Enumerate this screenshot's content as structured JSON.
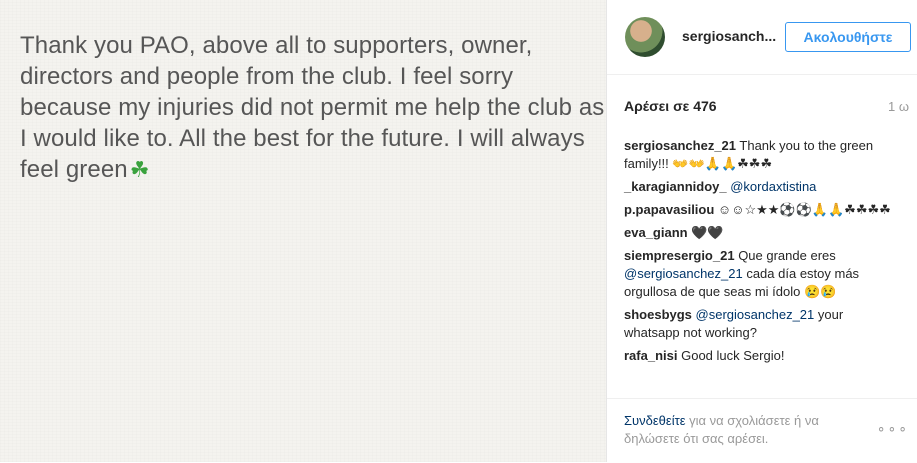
{
  "post": {
    "text": "Thank you PAO, above all to supporters, owner, directors and people from the club. I feel sorry because my injuries did not permit me help the club as I would like to. All the best for the future. I will always feel green",
    "emoji": "☘"
  },
  "header": {
    "username": "sergiosanch...",
    "follow_label": "Ακολουθήστε"
  },
  "meta": {
    "likes": "Αρέσει σε 476",
    "time": "1 ω"
  },
  "comments": [
    {
      "user": "sergiosanchez_21",
      "mention": "",
      "text": " Thank you to the green family!!! 👐👐🙏🙏☘☘☘"
    },
    {
      "user": "_karagiannidoy_",
      "mention": "@kordaxtistina",
      "text": ""
    },
    {
      "user": "p.papavasiliou",
      "mention": "",
      "text": " ☺☺☆★★⚽⚽🙏🙏☘☘☘☘"
    },
    {
      "user": "eva_giann",
      "mention": "",
      "text": " 🖤🖤"
    },
    {
      "user": "siempresergio_21",
      "mention": "",
      "text": " Que grande eres "
    },
    {
      "user": "",
      "mention": "@sergiosanchez_21",
      "text": " cada día estoy más orgullosa de que seas mi ídolo 😢😢"
    },
    {
      "user": "shoesbygs",
      "mention": "@sergiosanchez_21",
      "text": " your whatsapp not working?"
    },
    {
      "user": "rafa_nisi",
      "mention": "",
      "text": " Good luck Sergio!"
    }
  ],
  "footer": {
    "login_link": "Συνδεθείτε",
    "login_text": " για να σχολιάσετε ή να δηλώσετε ότι σας αρέσει.",
    "more": "∘∘∘"
  }
}
